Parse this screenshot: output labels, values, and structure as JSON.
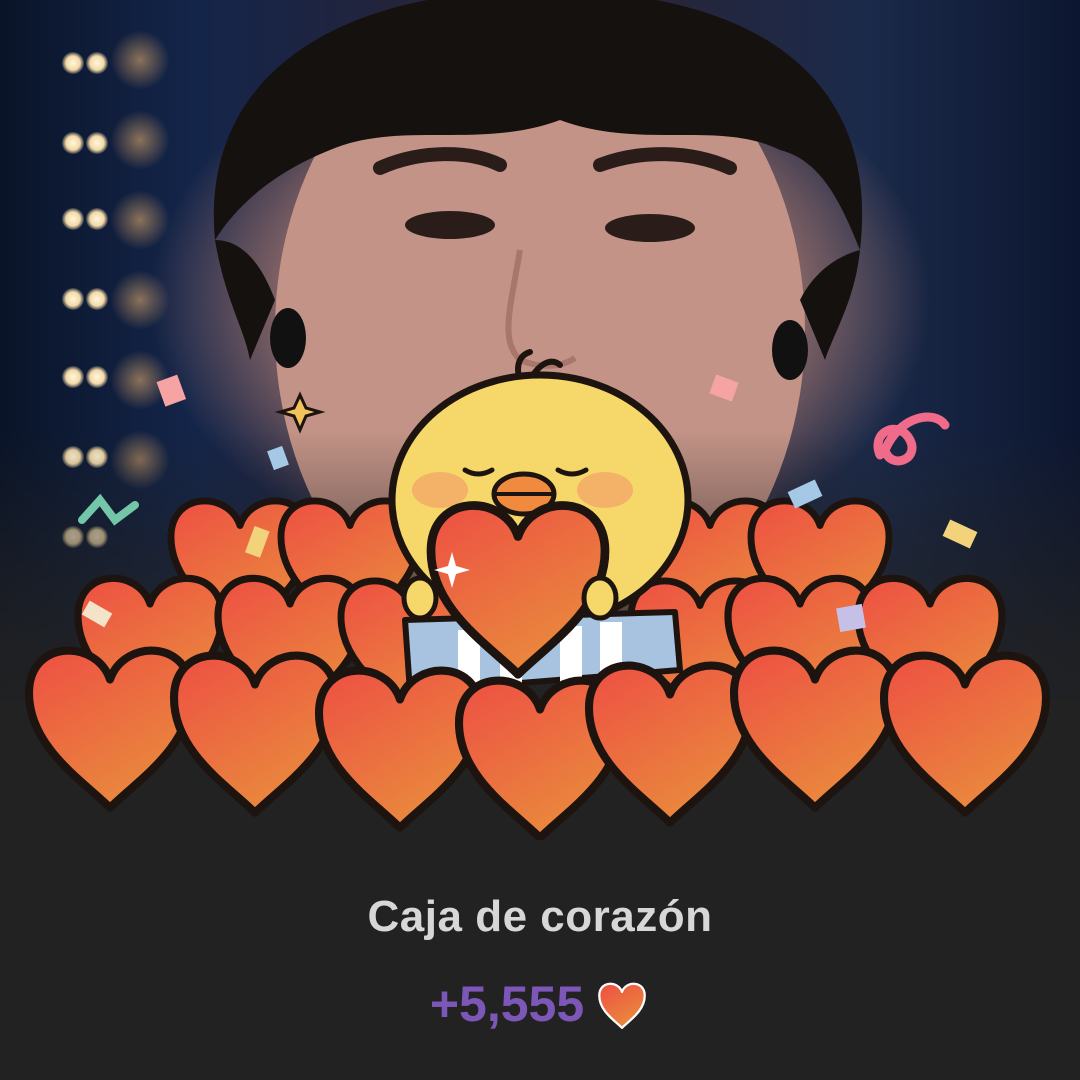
{
  "reward": {
    "title": "Caja de corazón",
    "points": "+5,555"
  },
  "icons": {
    "points_icon": "heart-icon",
    "mascot": "yellow-chick-holding-heart",
    "background": "performer-photo"
  },
  "colors": {
    "background": "#222222",
    "title": "#d7d7d7",
    "points": "#7c57b8",
    "heart_fill_top": "#f06a4f",
    "heart_fill_bottom": "#e7893f",
    "chick": "#f6d76a"
  }
}
